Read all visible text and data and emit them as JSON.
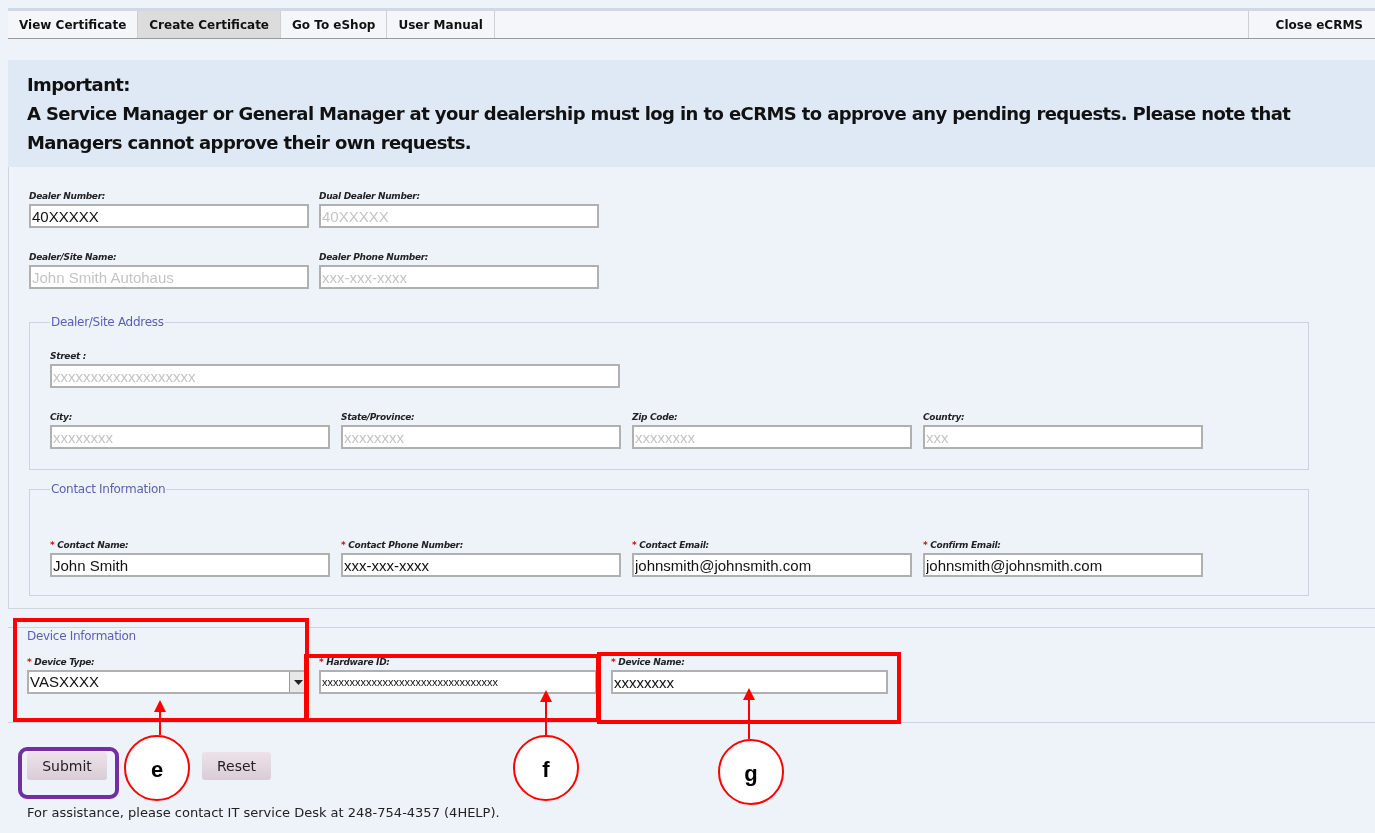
{
  "tabs": [
    {
      "label": "View Certificate",
      "selected": false
    },
    {
      "label": "Create Certificate",
      "selected": true
    },
    {
      "label": "Go To eShop",
      "selected": false
    },
    {
      "label": "User Manual",
      "selected": false
    }
  ],
  "close_tab": {
    "label": "Close eCRMS"
  },
  "notice": {
    "title": "Important:",
    "text": "A Service Manager or General Manager at your dealership must log in to eCRMS to approve any pending requests. Please note that Managers cannot approve their own requests."
  },
  "dealer_fields": [
    {
      "label": "Dealer Number:",
      "value": "40XXXXX"
    },
    {
      "label": "Dual Dealer Number:",
      "placeholder": "40XXXXX"
    },
    {
      "label": "Dealer/Site Name:",
      "placeholder": "John Smith Autohaus"
    },
    {
      "label": "Dealer Phone Number:",
      "placeholder": "xxx-xxx-xxxx"
    }
  ],
  "address": {
    "legend": "Dealer/Site Address",
    "street": {
      "label": "Street :",
      "placeholder": "xxxxxxxxxxxxxxxxxxx"
    },
    "fields": [
      {
        "label": "City:",
        "placeholder": "xxxxxxxx"
      },
      {
        "label": "State/Province:",
        "placeholder": "xxxxxxxx"
      },
      {
        "label": "Zip Code:",
        "placeholder": "xxxxxxxx"
      },
      {
        "label": "Country:",
        "placeholder": "xxx"
      }
    ]
  },
  "contact": {
    "legend": "Contact Information",
    "fields": [
      {
        "marker": "*",
        "label": "Contact Name:",
        "value": "John Smith"
      },
      {
        "marker": "*",
        "label": "Contact Phone Number:",
        "value": "xxx-xxx-xxxx"
      },
      {
        "marker": "*",
        "label": "Contact Email:",
        "value": "johnsmith@johnsmith.com"
      },
      {
        "marker": "*",
        "label": "Confirm Email:",
        "value": "johnsmith@johnsmith.com"
      }
    ]
  },
  "device": {
    "legend": "Device Information",
    "fields": [
      {
        "kind": "select",
        "marker": "*",
        "label": "Device Type:",
        "value": "VASXXXX"
      },
      {
        "kind": "text",
        "marker": "*",
        "label": "Hardware ID:",
        "value": "xxxxxxxxxxxxxxxxxxxxxxxxxxxxxxxx"
      },
      {
        "kind": "text",
        "marker": "*",
        "label": "Device Name:",
        "value": "xxxxxxxx"
      }
    ]
  },
  "buttons": [
    "Submit",
    "Reset"
  ],
  "footer": "For assistance, please contact IT service Desk at 248-754-4357 (4HELP).",
  "callouts": [
    {
      "label": "e"
    },
    {
      "label": "f"
    },
    {
      "label": "g"
    }
  ]
}
